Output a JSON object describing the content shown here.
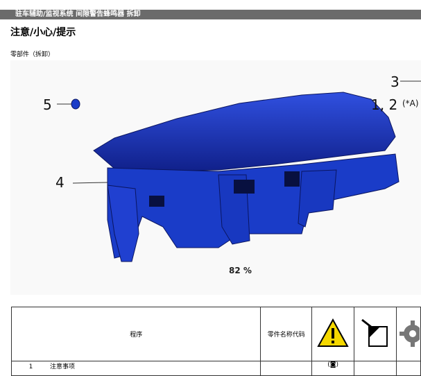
{
  "header": {
    "breadcrumb": "驻车辅助/监视系统  间隙警告蜂鸣器  拆卸"
  },
  "page": {
    "title": "注意/小心/提示",
    "section_label": "零部件（拆卸）"
  },
  "figure": {
    "callouts": {
      "c1": "1, 2",
      "c1_note": "(*A)",
      "c3": "3",
      "c4": "4",
      "c5": "5"
    },
    "zoom": "82 %",
    "part_color": "#1a3cc8"
  },
  "table": {
    "headers": {
      "procedure": "程序",
      "part_code": "零件名称代码"
    },
    "icons": [
      "warning-triangle-icon",
      "tool-icon",
      "gear-icon"
    ],
    "rows": [
      {
        "num": "1",
        "procedure": "注意事项",
        "part_code": "",
        "note": "(◙)"
      }
    ]
  }
}
